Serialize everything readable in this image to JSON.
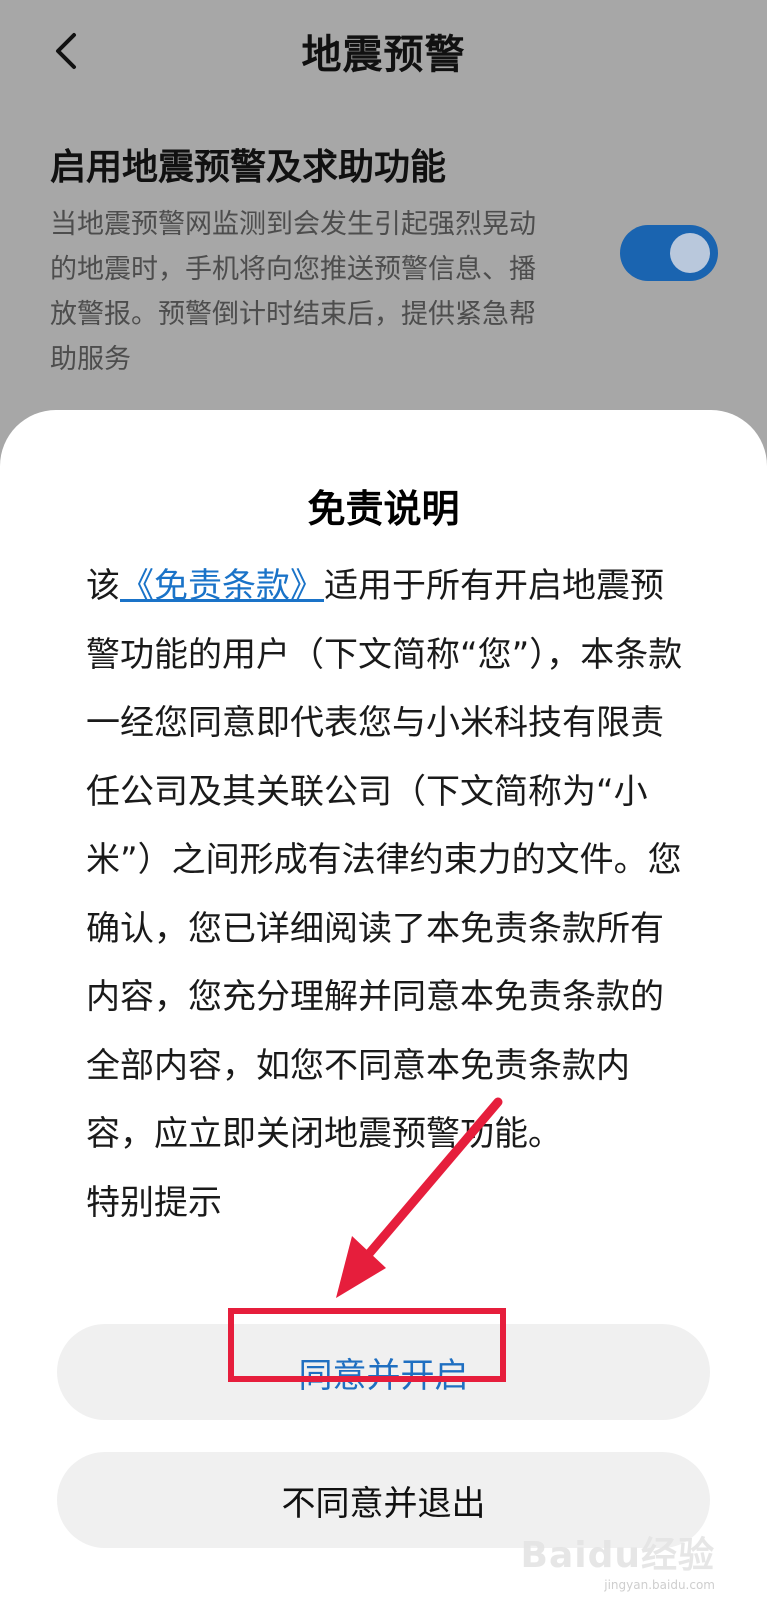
{
  "header": {
    "title": "地震预警",
    "back_icon": "chevron-left-icon"
  },
  "setting": {
    "title": "启用地震预警及求助功能",
    "description": "当地震预警网监测到会发生引起强烈晃动的地震时，手机将向您推送预警信息、播放警报。预警倒计时结束后，提供紧急帮助服务",
    "toggle_state": "on",
    "toggle_color": "#1a64b0"
  },
  "dialog": {
    "title": "免责说明",
    "body_prefix": "该",
    "terms_link": "《免责条款》",
    "body_main": "适用于所有开启地震预警功能的用户（下文简称“您”），本条款一经您同意即代表您与小米科技有限责任公司及其关联公司（下文简称为“小米”）之间形成有法律约束力的文件。您确认，您已详细阅读了本免责条款所有内容，您充分理解并同意本免责条款的全部内容，如您不同意本免责条款内容，应立即关闭地震预警功能。",
    "body_next_heading": "特别提示",
    "agree_button": "同意并开启",
    "decline_button": "不同意并退出"
  },
  "annotation": {
    "highlight_color": "#e61e3c",
    "arrow_icon": "red-arrow-icon"
  },
  "watermark": {
    "brand": "Baidu经验",
    "url": "jingyan.baidu.com"
  }
}
